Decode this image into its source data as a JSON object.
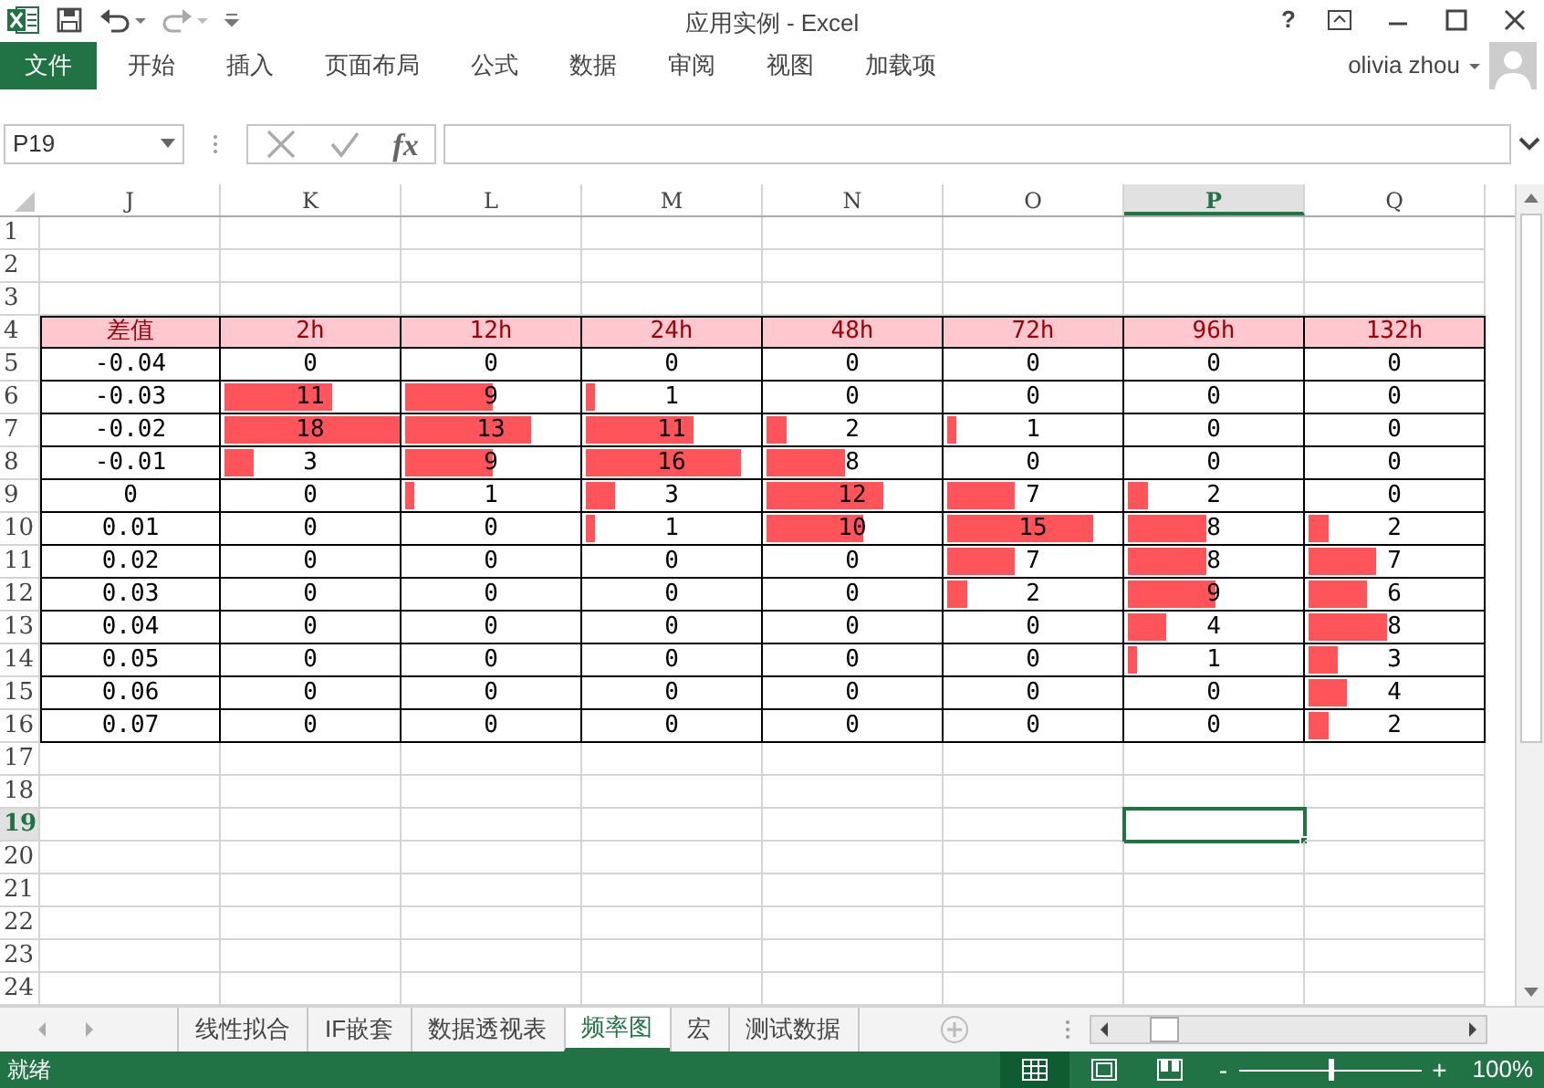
{
  "window": {
    "title": "应用实例 - Excel",
    "help": "?"
  },
  "ribbon": {
    "tabs": [
      {
        "label": "文件",
        "kind": "file"
      },
      {
        "label": "开始",
        "kind": "tab"
      },
      {
        "label": "插入",
        "kind": "tab"
      },
      {
        "label": "页面布局",
        "kind": "tab"
      },
      {
        "label": "公式",
        "kind": "tab"
      },
      {
        "label": "数据",
        "kind": "tab"
      },
      {
        "label": "审阅",
        "kind": "tab"
      },
      {
        "label": "视图",
        "kind": "tab"
      },
      {
        "label": "加载项",
        "kind": "tab"
      }
    ],
    "user": "olivia zhou"
  },
  "formula_bar": {
    "name_box": "P19",
    "fx": "fx"
  },
  "sheet": {
    "columns": [
      {
        "label": "J",
        "selected": false
      },
      {
        "label": "K",
        "selected": false
      },
      {
        "label": "L",
        "selected": false
      },
      {
        "label": "M",
        "selected": false
      },
      {
        "label": "N",
        "selected": false
      },
      {
        "label": "O",
        "selected": false
      },
      {
        "label": "P",
        "selected": true
      },
      {
        "label": "Q",
        "selected": false
      }
    ],
    "row_numbers": [
      {
        "label": "1",
        "selected": false
      },
      {
        "label": "2",
        "selected": false
      },
      {
        "label": "3",
        "selected": false
      },
      {
        "label": "4",
        "selected": false
      },
      {
        "label": "5",
        "selected": false
      },
      {
        "label": "6",
        "selected": false
      },
      {
        "label": "7",
        "selected": false
      },
      {
        "label": "8",
        "selected": false
      },
      {
        "label": "9",
        "selected": false
      },
      {
        "label": "10",
        "selected": false
      },
      {
        "label": "11",
        "selected": false
      },
      {
        "label": "12",
        "selected": false
      },
      {
        "label": "13",
        "selected": false
      },
      {
        "label": "14",
        "selected": false
      },
      {
        "label": "15",
        "selected": false
      },
      {
        "label": "16",
        "selected": false
      },
      {
        "label": "17",
        "selected": false
      },
      {
        "label": "18",
        "selected": false
      },
      {
        "label": "19",
        "selected": true
      },
      {
        "label": "20",
        "selected": false
      },
      {
        "label": "21",
        "selected": false
      },
      {
        "label": "22",
        "selected": false
      },
      {
        "label": "23",
        "selected": false
      },
      {
        "label": "24",
        "selected": false
      }
    ],
    "table": {
      "header": [
        "差值",
        "2h",
        "12h",
        "24h",
        "48h",
        "72h",
        "96h",
        "132h"
      ],
      "rows": [
        {
          "label": "-0.04",
          "cells": [
            {
              "value": "0"
            },
            {
              "value": "0"
            },
            {
              "value": "0"
            },
            {
              "value": "0"
            },
            {
              "value": "0"
            },
            {
              "value": "0"
            },
            {
              "value": "0"
            }
          ]
        },
        {
          "label": "-0.03",
          "cells": [
            {
              "value": "11",
              "level": 0.611
            },
            {
              "value": "9",
              "level": 0.5
            },
            {
              "value": "1",
              "level": 0.056
            },
            {
              "value": "0"
            },
            {
              "value": "0"
            },
            {
              "value": "0"
            },
            {
              "value": "0"
            }
          ]
        },
        {
          "label": "-0.02",
          "cells": [
            {
              "value": "18",
              "level": 1
            },
            {
              "value": "13",
              "level": 0.722
            },
            {
              "value": "11",
              "level": 0.611
            },
            {
              "value": "2",
              "level": 0.111
            },
            {
              "value": "1",
              "level": 0.056
            },
            {
              "value": "0"
            },
            {
              "value": "0"
            }
          ]
        },
        {
          "label": "-0.01",
          "cells": [
            {
              "value": "3",
              "level": 0.167
            },
            {
              "value": "9",
              "level": 0.5
            },
            {
              "value": "16",
              "level": 0.889
            },
            {
              "value": "8",
              "level": 0.444
            },
            {
              "value": "0"
            },
            {
              "value": "0"
            },
            {
              "value": "0"
            }
          ]
        },
        {
          "label": "0",
          "cells": [
            {
              "value": "0"
            },
            {
              "value": "1",
              "level": 0.056
            },
            {
              "value": "3",
              "level": 0.167
            },
            {
              "value": "12",
              "level": 0.667
            },
            {
              "value": "7",
              "level": 0.389
            },
            {
              "value": "2",
              "level": 0.111
            },
            {
              "value": "0"
            }
          ]
        },
        {
          "label": "0.01",
          "cells": [
            {
              "value": "0"
            },
            {
              "value": "0"
            },
            {
              "value": "1",
              "level": 0.056
            },
            {
              "value": "10",
              "level": 0.556
            },
            {
              "value": "15",
              "level": 0.833
            },
            {
              "value": "8",
              "level": 0.444
            },
            {
              "value": "2",
              "level": 0.111
            }
          ]
        },
        {
          "label": "0.02",
          "cells": [
            {
              "value": "0"
            },
            {
              "value": "0"
            },
            {
              "value": "0"
            },
            {
              "value": "0"
            },
            {
              "value": "7",
              "level": 0.389
            },
            {
              "value": "8",
              "level": 0.444
            },
            {
              "value": "7",
              "level": 0.389
            }
          ]
        },
        {
          "label": "0.03",
          "cells": [
            {
              "value": "0"
            },
            {
              "value": "0"
            },
            {
              "value": "0"
            },
            {
              "value": "0"
            },
            {
              "value": "2",
              "level": 0.111
            },
            {
              "value": "9",
              "level": 0.5
            },
            {
              "value": "6",
              "level": 0.333
            }
          ]
        },
        {
          "label": "0.04",
          "cells": [
            {
              "value": "0"
            },
            {
              "value": "0"
            },
            {
              "value": "0"
            },
            {
              "value": "0"
            },
            {
              "value": "0"
            },
            {
              "value": "4",
              "level": 0.222
            },
            {
              "value": "8",
              "level": 0.444
            }
          ]
        },
        {
          "label": "0.05",
          "cells": [
            {
              "value": "0"
            },
            {
              "value": "0"
            },
            {
              "value": "0"
            },
            {
              "value": "0"
            },
            {
              "value": "0"
            },
            {
              "value": "1",
              "level": 0.056
            },
            {
              "value": "3",
              "level": 0.167
            }
          ]
        },
        {
          "label": "0.06",
          "cells": [
            {
              "value": "0"
            },
            {
              "value": "0"
            },
            {
              "value": "0"
            },
            {
              "value": "0"
            },
            {
              "value": "0"
            },
            {
              "value": "0"
            },
            {
              "value": "4",
              "level": 0.222
            }
          ]
        },
        {
          "label": "0.07",
          "cells": [
            {
              "value": "0"
            },
            {
              "value": "0"
            },
            {
              "value": "0"
            },
            {
              "value": "0"
            },
            {
              "value": "0"
            },
            {
              "value": "0"
            },
            {
              "value": "2",
              "level": 0.111
            }
          ]
        }
      ]
    }
  },
  "sheet_tabs": [
    {
      "label": "线性拟合",
      "selected": false
    },
    {
      "label": "IF嵌套",
      "selected": false
    },
    {
      "label": "数据透视表",
      "selected": false
    },
    {
      "label": "频率图",
      "selected": true
    },
    {
      "label": "宏",
      "selected": false
    },
    {
      "label": "测试数据",
      "selected": false
    }
  ],
  "status_bar": {
    "status": "就绪",
    "zoom_out": "-",
    "zoom_in": "+",
    "zoom": {
      "level": 0.5
    },
    "zoom_label": "100%"
  }
}
